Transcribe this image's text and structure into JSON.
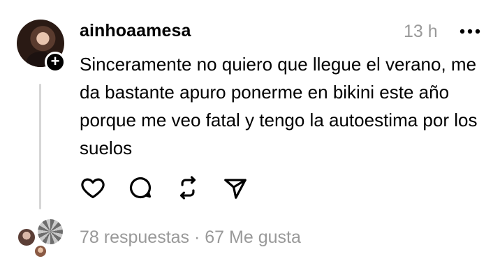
{
  "post": {
    "username": "ainhoaamesa",
    "time": "13 h",
    "text": "Sinceramente no quiero que llegue el verano, me da bastante apuro ponerme en bikini este año porque me veo fatal y tengo la autoestima por los suelos",
    "stats": "78 respuestas · 67 Me gusta"
  },
  "icons": {
    "more": "more-horizontal-icon",
    "like": "heart-icon",
    "reply": "comment-bubble-icon",
    "repost": "repost-icon",
    "share": "send-icon",
    "follow": "plus-icon"
  },
  "colors": {
    "text": "#000000",
    "muted": "#999999",
    "thread_line": "#d6d6d6",
    "background": "#ffffff"
  }
}
